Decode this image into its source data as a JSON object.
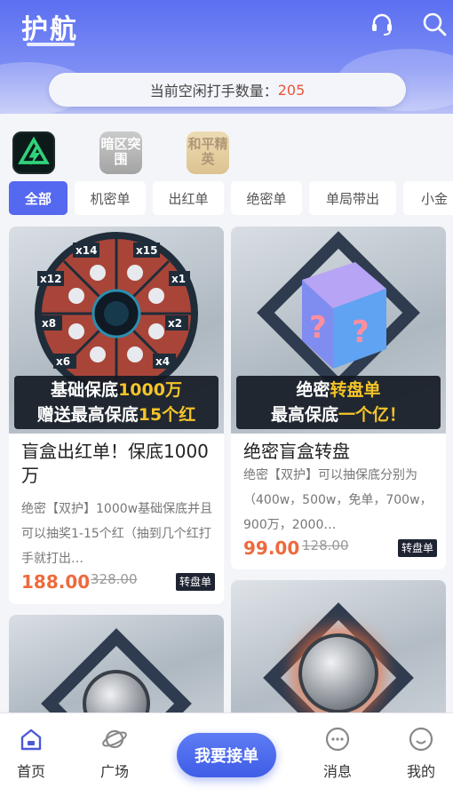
{
  "header": {
    "title": "护航",
    "support_icon": "headset-icon",
    "search_icon": "search-icon"
  },
  "idle": {
    "label": "当前空闲打手数量：",
    "count": "205"
  },
  "games": [
    {
      "name": "game-icon-1"
    },
    {
      "name": "game-icon-2",
      "text": "暗区突围"
    },
    {
      "name": "game-icon-3",
      "text": "和平精英"
    }
  ],
  "tabs": [
    "全部",
    "机密单",
    "出红单",
    "绝密单",
    "单局带出",
    "小金"
  ],
  "cards": [
    {
      "banner_line1_a": "基础保底",
      "banner_line1_b": "1000万",
      "banner_line2_a": "赠送最高保底",
      "banner_line2_b": "15个红",
      "wheel_labels": [
        "x14",
        "x15",
        "x12",
        "x1",
        "x8",
        "x2",
        "x6",
        "x4"
      ],
      "title": "盲盒出红单！保底1000万",
      "desc": "绝密【双护】1000w基础保底并且可以抽奖1-15个红（抽到几个红打手就打出…",
      "price": "188.00",
      "original_price": "328.00",
      "tag": "转盘单"
    },
    {
      "banner_line1_a": "绝密",
      "banner_line1_b": "转盘单",
      "banner_line2_a": "最高保底",
      "banner_line2_b": "一个亿！",
      "title": "绝密盲盒转盘",
      "desc": "绝密【双护】可以抽保底分别为（400w，500w，免单，700w，900万，2000…",
      "price": "99.00",
      "original_price": "128.00",
      "tag": "转盘单"
    }
  ],
  "tabbar": {
    "home": "首页",
    "plaza": "广场",
    "center": "我要接单",
    "messages": "消息",
    "mine": "我的"
  }
}
